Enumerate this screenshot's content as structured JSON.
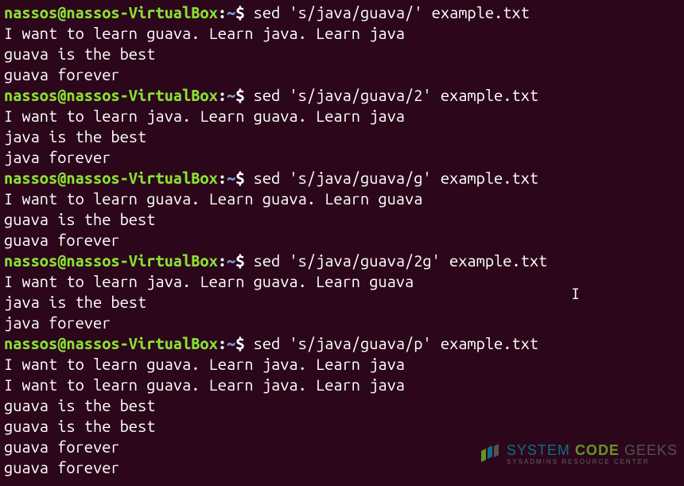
{
  "prompt": {
    "user": "nassos",
    "at": "@",
    "host": "nassos-VirtualBox",
    "colon": ":",
    "path": "~",
    "dollar": "$"
  },
  "blocks": [
    {
      "command": "sed 's/java/guava/' example.txt",
      "output": [
        "I want to learn guava. Learn java. Learn java",
        "guava is the best",
        "guava forever"
      ]
    },
    {
      "command": "sed 's/java/guava/2' example.txt",
      "output": [
        "I want to learn java. Learn guava. Learn java",
        "java is the best",
        "java forever"
      ]
    },
    {
      "command": "sed 's/java/guava/g' example.txt",
      "output": [
        "I want to learn guava. Learn guava. Learn guava",
        "guava is the best",
        "guava forever"
      ]
    },
    {
      "command": "sed 's/java/guava/2g' example.txt",
      "output": [
        "I want to learn java. Learn guava. Learn guava",
        "java is the best",
        "java forever"
      ]
    },
    {
      "command": "sed 's/java/guava/p' example.txt",
      "output": [
        "I want to learn guava. Learn java. Learn java",
        "I want to learn guava. Learn java. Learn java",
        "guava is the best",
        "guava is the best",
        "guava forever",
        "guava forever"
      ]
    }
  ],
  "watermark": {
    "w1": "SYSTEM",
    "w2": "CODE",
    "w3": "GEEKS",
    "sub": "SYSADMINS RESOURCE CENTER"
  }
}
